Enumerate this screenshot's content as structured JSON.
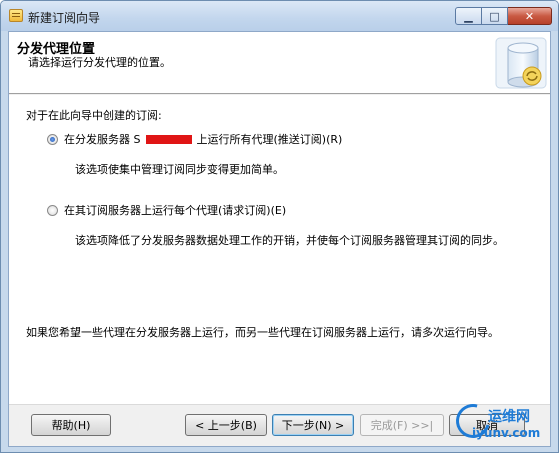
{
  "window": {
    "title": "新建订阅向导",
    "controls": {
      "minimize": "▁",
      "maximize": "□",
      "close": "✕"
    }
  },
  "header": {
    "title": "分发代理位置",
    "subtitle": "请选择运行分发代理的位置。",
    "graphic_icon": "database-wizard-icon"
  },
  "body": {
    "prompt": "对于在此向导中创建的订阅:",
    "options": [
      {
        "label_prefix": "在分发服务器 S",
        "label_suffix": "上运行所有代理(推送订阅)(R)",
        "selected": true,
        "description": "该选项使集中管理订阅同步变得更加简单。"
      },
      {
        "label": "在其订阅服务器上运行每个代理(请求订阅)(E)",
        "selected": false,
        "description": "该选项降低了分发服务器数据处理工作的开销，并使每个订阅服务器管理其订阅的同步。"
      }
    ],
    "footnote": "如果您希望一些代理在分发服务器上运行，而另一些代理在订阅服务器上运行，请多次运行向导。"
  },
  "footer": {
    "help": "帮助(H)",
    "back": "< 上一步(B)",
    "next": "下一步(N) >",
    "finish": "完成(F) >>|",
    "cancel": "取消"
  },
  "watermark": {
    "cn": "运维网",
    "en": "iyunv.com"
  }
}
